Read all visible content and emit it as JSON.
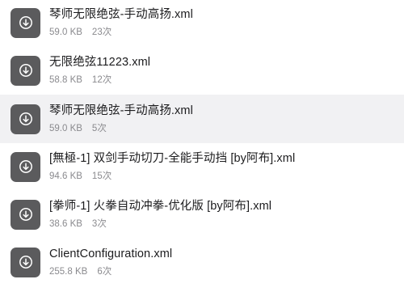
{
  "files": [
    {
      "name": "琴师无限绝弦-手动高扬.xml",
      "size": "59.0 KB",
      "count": "23次",
      "icon": "download-file-icon",
      "highlighted": false
    },
    {
      "name": "无限绝弦11223.xml",
      "size": "58.8 KB",
      "count": "12次",
      "icon": "download-file-icon",
      "highlighted": false
    },
    {
      "name": "琴师无限绝弦-手动高扬.xml",
      "size": "59.0 KB",
      "count": "5次",
      "icon": "download-file-icon",
      "highlighted": true
    },
    {
      "name": "[無極-1] 双剑手动切刀-全能手动挡 [by阿布].xml",
      "size": "94.6 KB",
      "count": "15次",
      "icon": "download-file-icon",
      "highlighted": false
    },
    {
      "name": "[拳师-1] 火拳自动冲拳-优化版 [by阿布].xml",
      "size": "38.6 KB",
      "count": "3次",
      "icon": "download-file-icon",
      "highlighted": false
    },
    {
      "name": "ClientConfiguration.xml",
      "size": "255.8 KB",
      "count": "6次",
      "icon": "download-file-icon",
      "highlighted": false
    }
  ],
  "colors": {
    "icon_bg": "#5b5b5d",
    "highlight_bg": "#f1f1f3",
    "name_text": "#1c1c1e",
    "meta_text": "#8a8a8e"
  }
}
